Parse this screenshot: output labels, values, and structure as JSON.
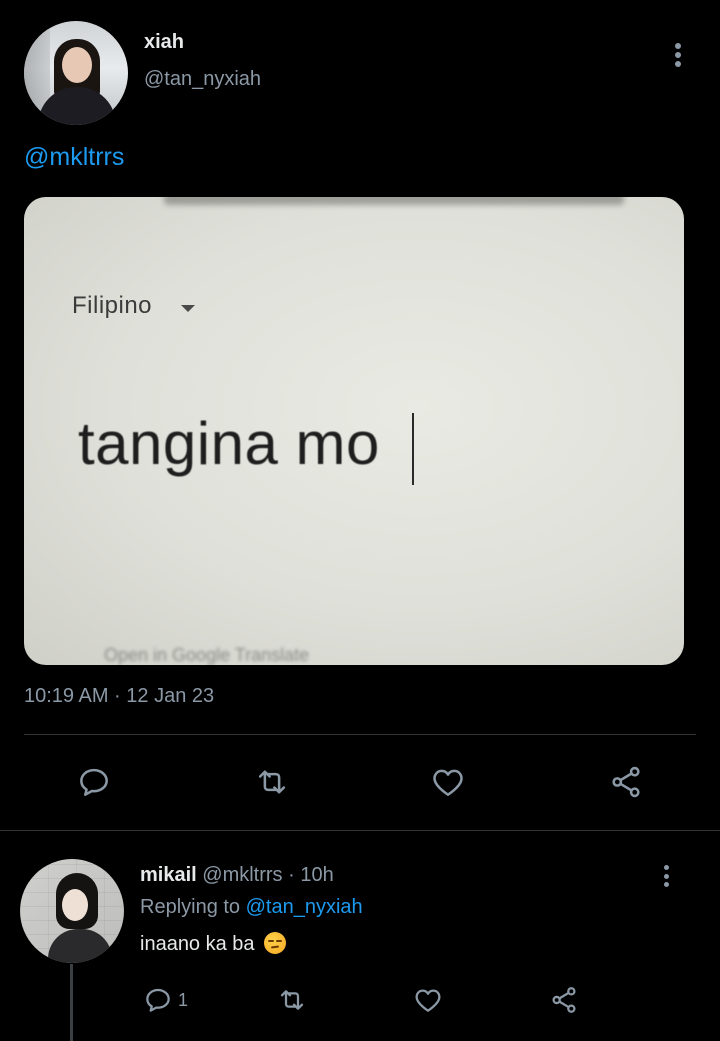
{
  "tweet": {
    "author_name": "xiah",
    "author_handle": "@tan_nyxiah",
    "text": "@mkltrrs",
    "media": {
      "language_label": "Filipino",
      "typed_text": "tangina mo",
      "footer_text": "Open in Google Translate"
    },
    "timestamp": "10:19 AM · 12 Jan 23",
    "actions": [
      "reply-icon",
      "retweet-icon",
      "like-icon",
      "share-icon"
    ]
  },
  "reply": {
    "author_name": "mikail",
    "meta": "@mkltrrs · 10h",
    "replying_prefix": "Replying to",
    "replying_handle": "@tan_nyxiah",
    "text": "inaano ka ba",
    "emoji": "unamused-face",
    "reply_count": "1",
    "actions": [
      "reply-icon",
      "retweet-icon",
      "like-icon",
      "share-icon"
    ]
  },
  "colors": {
    "background": "#000000",
    "text": "#e7e9ea",
    "secondary": "#8b98a5",
    "link": "#1d9bf0",
    "divider": "#2f3336"
  }
}
